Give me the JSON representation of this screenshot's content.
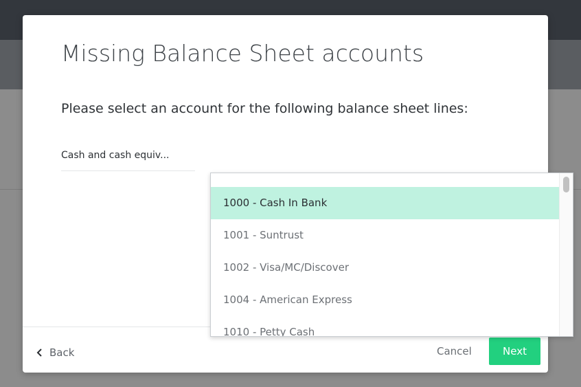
{
  "modal": {
    "title": "Missing Balance Sheet accounts",
    "subtitle": "Please select an account for the following balance sheet lines:"
  },
  "balance_line": {
    "label": "Cash and cash equiv..."
  },
  "dropdown": {
    "options": [
      {
        "label": "1000 - Cash In Bank",
        "selected": true
      },
      {
        "label": "1001 - Suntrust",
        "selected": false
      },
      {
        "label": "1002 - Visa/MC/Discover",
        "selected": false
      },
      {
        "label": "1004 - American Express",
        "selected": false
      },
      {
        "label": "1010 - Petty Cash",
        "selected": false
      }
    ]
  },
  "footer": {
    "back_label": "Back",
    "cancel_label": "Cancel",
    "next_label": "Next"
  },
  "colors": {
    "accent": "#22d07f",
    "selected_row": "#bff2e0",
    "overlay": "#8c8c8c"
  },
  "icons": {
    "back": "chevron-left-icon"
  }
}
